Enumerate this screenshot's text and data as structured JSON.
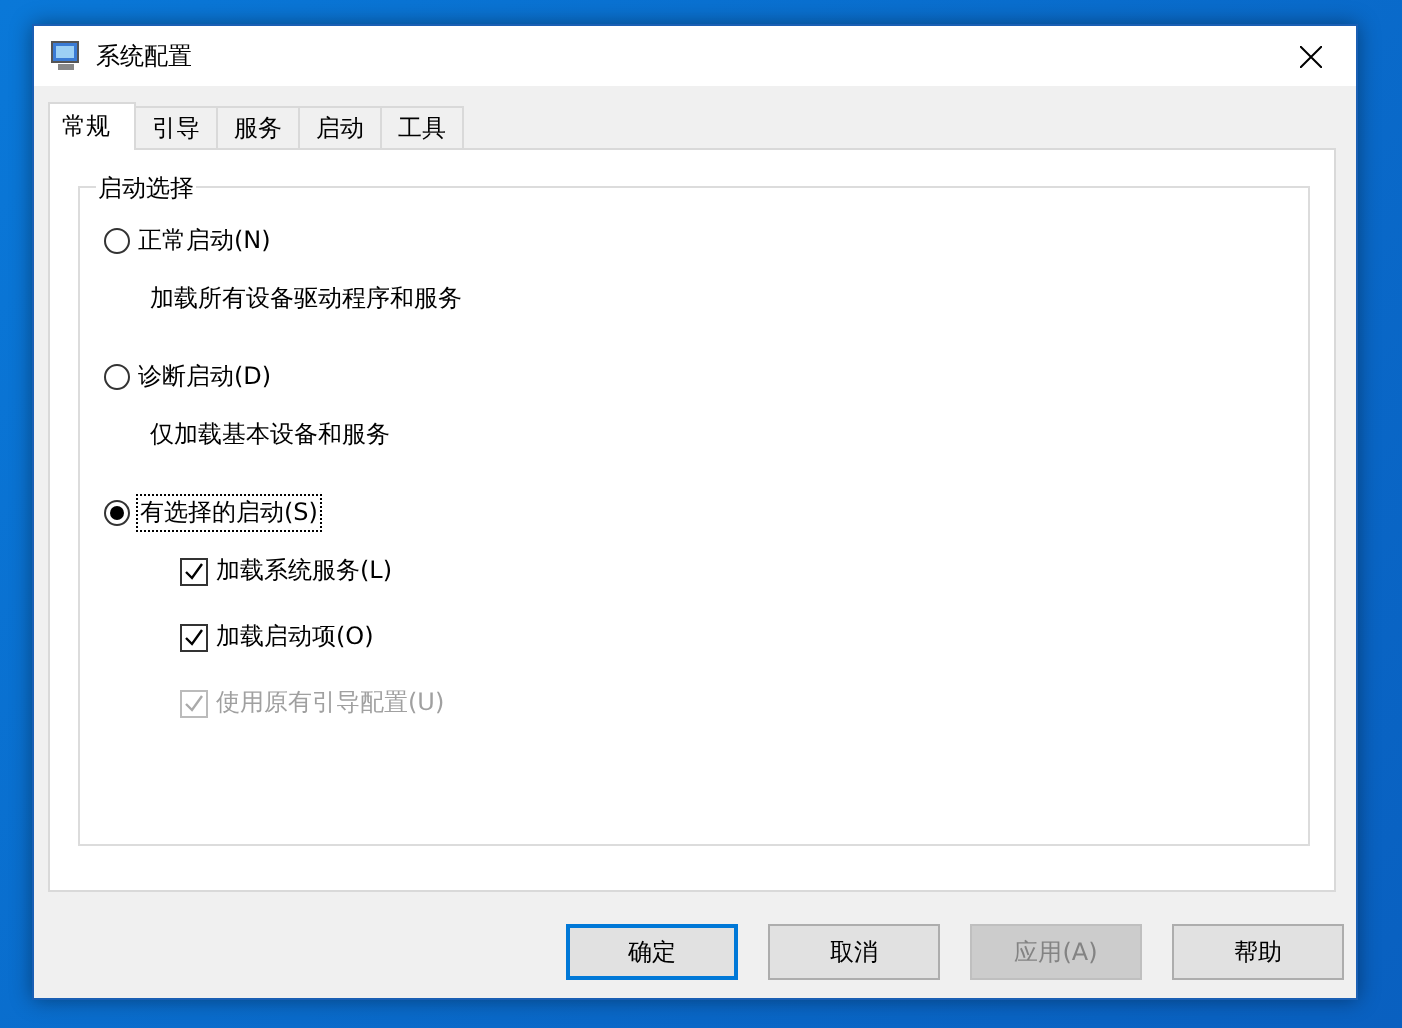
{
  "window": {
    "title": "系统配置"
  },
  "tabs": [
    {
      "label": "常规",
      "selected": true
    },
    {
      "label": "引导",
      "selected": false
    },
    {
      "label": "服务",
      "selected": false
    },
    {
      "label": "启动",
      "selected": false
    },
    {
      "label": "工具",
      "selected": false
    }
  ],
  "group": {
    "title": "启动选择"
  },
  "options": [
    {
      "label": "正常启动(N)",
      "selected": false,
      "description": "加载所有设备驱动程序和服务"
    },
    {
      "label": "诊断启动(D)",
      "selected": false,
      "description": "仅加载基本设备和服务"
    },
    {
      "label": "有选择的启动(S)",
      "selected": true
    }
  ],
  "checkboxes": [
    {
      "label": "加载系统服务(L)",
      "checked": true,
      "disabled": false
    },
    {
      "label": "加载启动项(O)",
      "checked": true,
      "disabled": false
    },
    {
      "label": "使用原有引导配置(U)",
      "checked": true,
      "disabled": true
    }
  ],
  "buttons": [
    {
      "label": "确定",
      "default": true,
      "disabled": false
    },
    {
      "label": "取消",
      "default": false,
      "disabled": false
    },
    {
      "label": "应用(A)",
      "default": false,
      "disabled": true
    },
    {
      "label": "帮助",
      "default": false,
      "disabled": false
    }
  ]
}
